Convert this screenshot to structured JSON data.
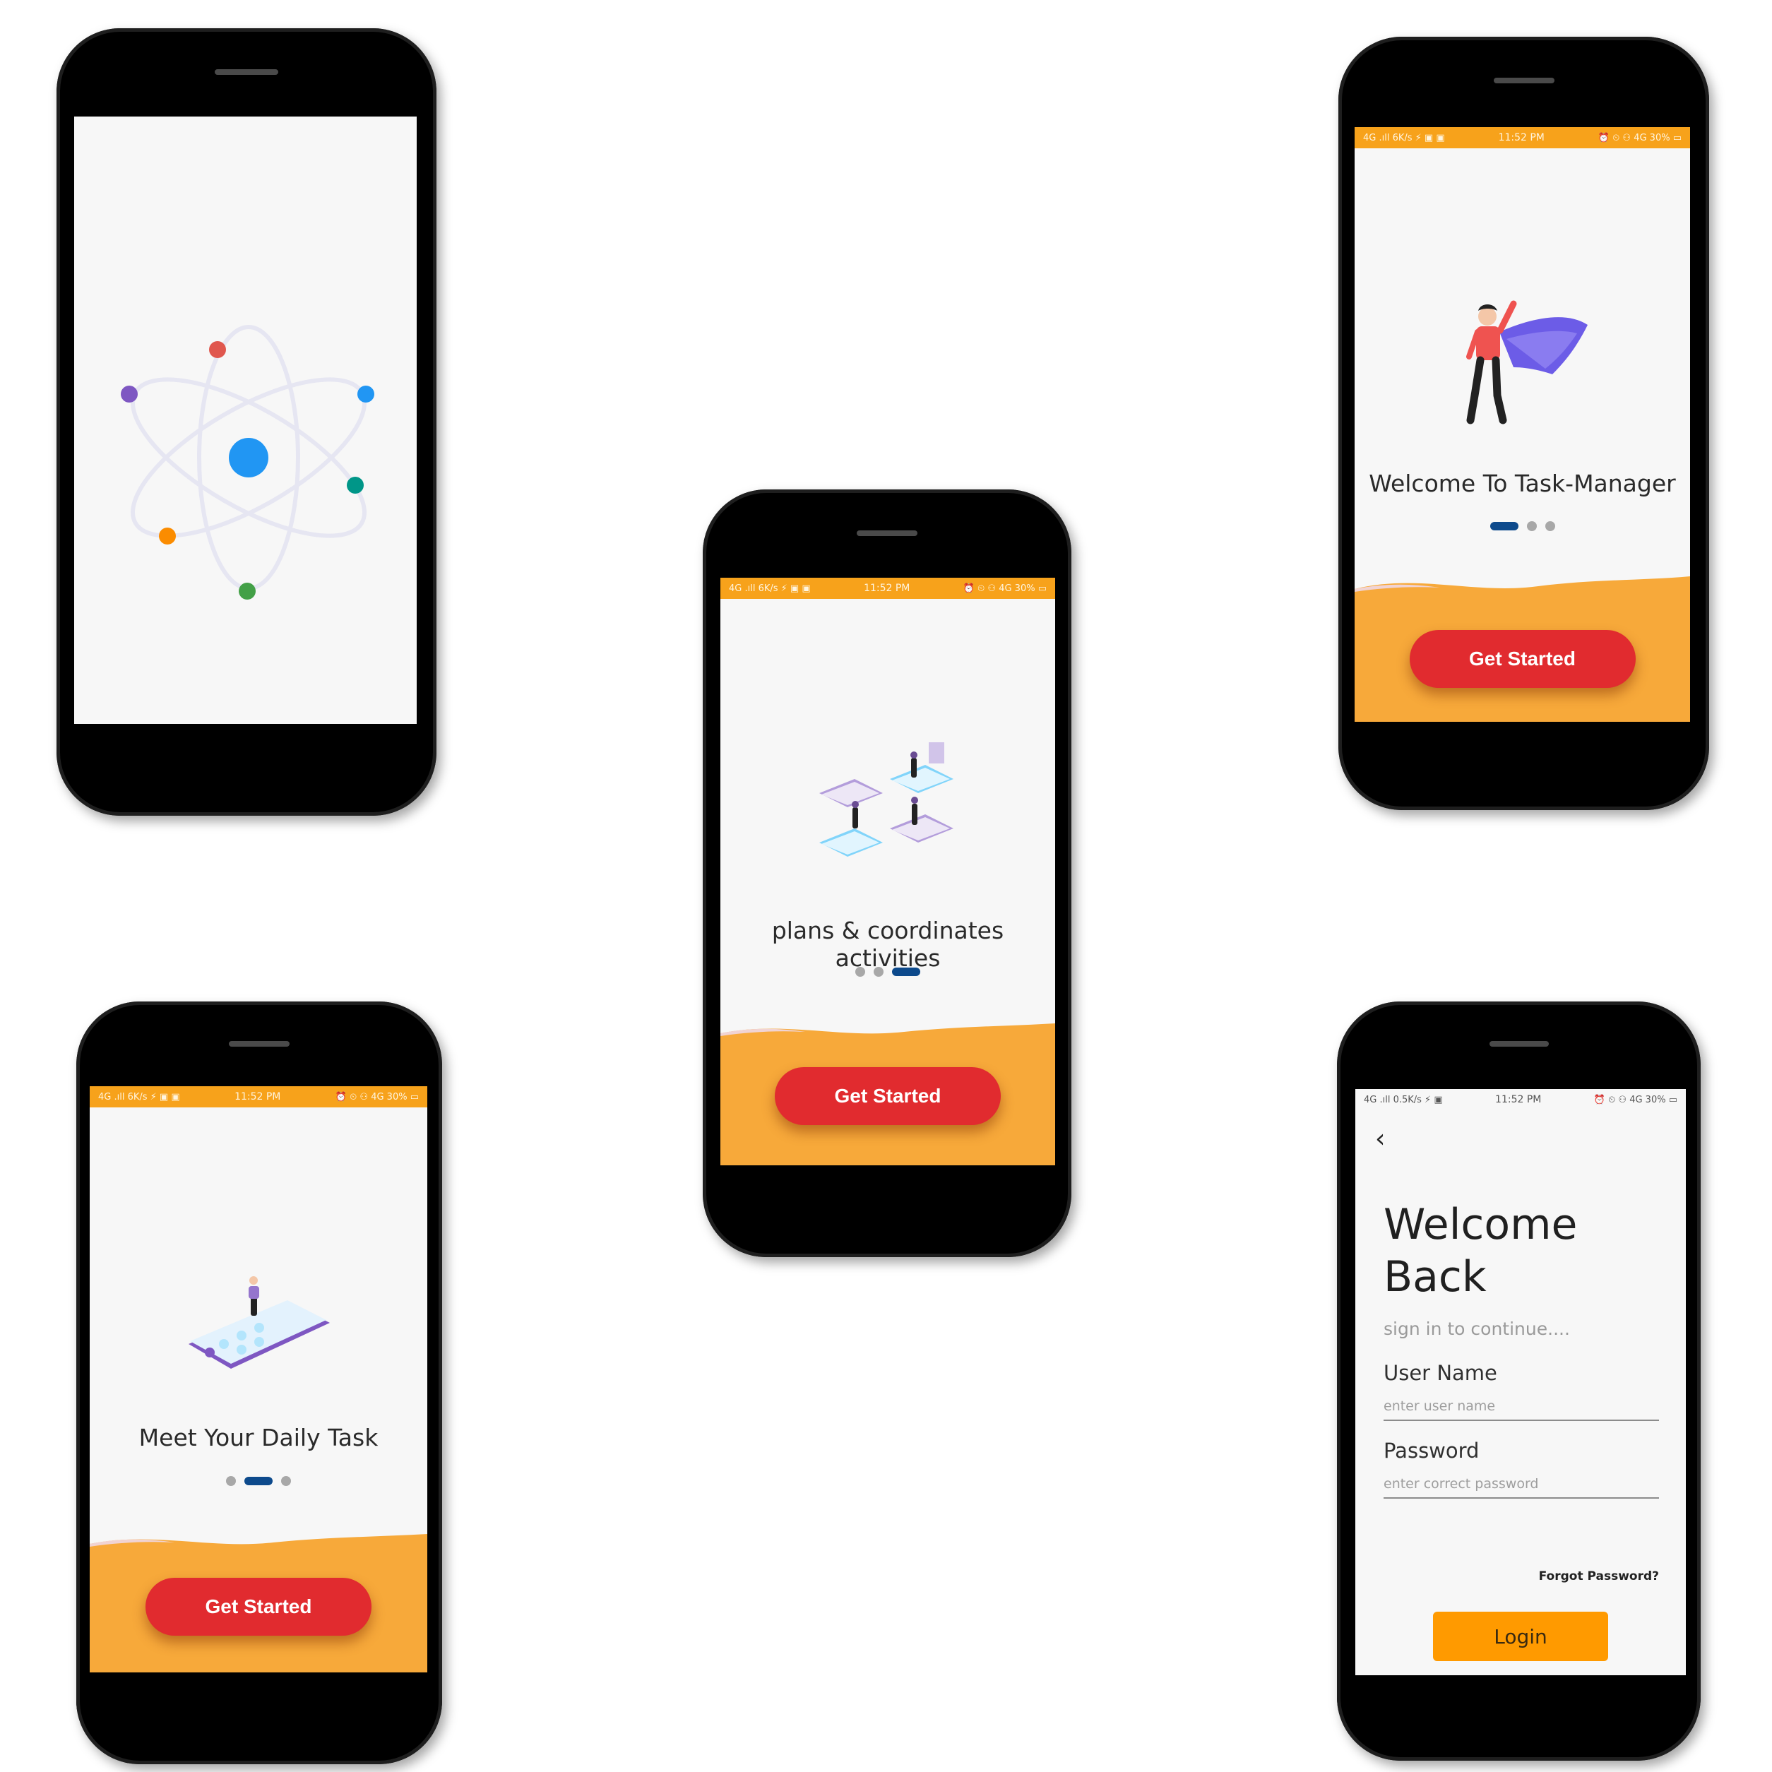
{
  "status_bar": {
    "left": "4G .ıll 6K/s ⚡ ▣ ▣",
    "time": "11:52 PM",
    "right": "⏰ ⏲ ⚇ 4G 30% ▭"
  },
  "status_bar_login": {
    "left": "4G .ıll 0.5K/s ⚡ ▣",
    "time": "11:52 PM",
    "right": "⏰ ⏲ ⚇ 4G 30% ▭"
  },
  "onboarding": {
    "welcome_caption": "Welcome To Task-Manager",
    "daily_caption": "Meet Your Daily Task",
    "plans_caption": "plans & coordinates activities",
    "button_label": "Get Started"
  },
  "login": {
    "back_glyph": "‹",
    "title_line1": "Welcome",
    "title_line2": "Back",
    "subtitle": "sign in to continue....",
    "username_label": "User Name",
    "username_placeholder": "enter user name",
    "password_label": "Password",
    "password_placeholder": "enter correct password",
    "forgot": "Forgot Password?",
    "login_button": "Login"
  },
  "colors": {
    "accent_orange": "#f7a21b",
    "button_red": "#e12b2f",
    "dot_active": "#0d4a8c",
    "login_button": "#ff9a00"
  },
  "icons": {
    "splash": "atom-logo-icon",
    "back": "chevron-left-icon"
  }
}
